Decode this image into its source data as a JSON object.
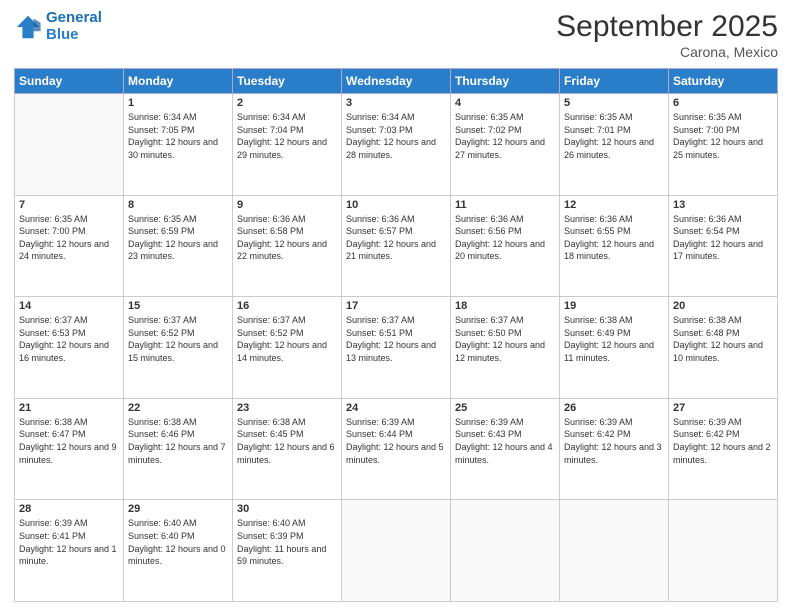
{
  "logo": {
    "line1": "General",
    "line2": "Blue"
  },
  "title": "September 2025",
  "location": "Carona, Mexico",
  "days_of_week": [
    "Sunday",
    "Monday",
    "Tuesday",
    "Wednesday",
    "Thursday",
    "Friday",
    "Saturday"
  ],
  "weeks": [
    [
      {
        "day": "",
        "sunrise": "",
        "sunset": "",
        "daylight": ""
      },
      {
        "day": "1",
        "sunrise": "Sunrise: 6:34 AM",
        "sunset": "Sunset: 7:05 PM",
        "daylight": "Daylight: 12 hours and 30 minutes."
      },
      {
        "day": "2",
        "sunrise": "Sunrise: 6:34 AM",
        "sunset": "Sunset: 7:04 PM",
        "daylight": "Daylight: 12 hours and 29 minutes."
      },
      {
        "day": "3",
        "sunrise": "Sunrise: 6:34 AM",
        "sunset": "Sunset: 7:03 PM",
        "daylight": "Daylight: 12 hours and 28 minutes."
      },
      {
        "day": "4",
        "sunrise": "Sunrise: 6:35 AM",
        "sunset": "Sunset: 7:02 PM",
        "daylight": "Daylight: 12 hours and 27 minutes."
      },
      {
        "day": "5",
        "sunrise": "Sunrise: 6:35 AM",
        "sunset": "Sunset: 7:01 PM",
        "daylight": "Daylight: 12 hours and 26 minutes."
      },
      {
        "day": "6",
        "sunrise": "Sunrise: 6:35 AM",
        "sunset": "Sunset: 7:00 PM",
        "daylight": "Daylight: 12 hours and 25 minutes."
      }
    ],
    [
      {
        "day": "7",
        "sunrise": "Sunrise: 6:35 AM",
        "sunset": "Sunset: 7:00 PM",
        "daylight": "Daylight: 12 hours and 24 minutes."
      },
      {
        "day": "8",
        "sunrise": "Sunrise: 6:35 AM",
        "sunset": "Sunset: 6:59 PM",
        "daylight": "Daylight: 12 hours and 23 minutes."
      },
      {
        "day": "9",
        "sunrise": "Sunrise: 6:36 AM",
        "sunset": "Sunset: 6:58 PM",
        "daylight": "Daylight: 12 hours and 22 minutes."
      },
      {
        "day": "10",
        "sunrise": "Sunrise: 6:36 AM",
        "sunset": "Sunset: 6:57 PM",
        "daylight": "Daylight: 12 hours and 21 minutes."
      },
      {
        "day": "11",
        "sunrise": "Sunrise: 6:36 AM",
        "sunset": "Sunset: 6:56 PM",
        "daylight": "Daylight: 12 hours and 20 minutes."
      },
      {
        "day": "12",
        "sunrise": "Sunrise: 6:36 AM",
        "sunset": "Sunset: 6:55 PM",
        "daylight": "Daylight: 12 hours and 18 minutes."
      },
      {
        "day": "13",
        "sunrise": "Sunrise: 6:36 AM",
        "sunset": "Sunset: 6:54 PM",
        "daylight": "Daylight: 12 hours and 17 minutes."
      }
    ],
    [
      {
        "day": "14",
        "sunrise": "Sunrise: 6:37 AM",
        "sunset": "Sunset: 6:53 PM",
        "daylight": "Daylight: 12 hours and 16 minutes."
      },
      {
        "day": "15",
        "sunrise": "Sunrise: 6:37 AM",
        "sunset": "Sunset: 6:52 PM",
        "daylight": "Daylight: 12 hours and 15 minutes."
      },
      {
        "day": "16",
        "sunrise": "Sunrise: 6:37 AM",
        "sunset": "Sunset: 6:52 PM",
        "daylight": "Daylight: 12 hours and 14 minutes."
      },
      {
        "day": "17",
        "sunrise": "Sunrise: 6:37 AM",
        "sunset": "Sunset: 6:51 PM",
        "daylight": "Daylight: 12 hours and 13 minutes."
      },
      {
        "day": "18",
        "sunrise": "Sunrise: 6:37 AM",
        "sunset": "Sunset: 6:50 PM",
        "daylight": "Daylight: 12 hours and 12 minutes."
      },
      {
        "day": "19",
        "sunrise": "Sunrise: 6:38 AM",
        "sunset": "Sunset: 6:49 PM",
        "daylight": "Daylight: 12 hours and 11 minutes."
      },
      {
        "day": "20",
        "sunrise": "Sunrise: 6:38 AM",
        "sunset": "Sunset: 6:48 PM",
        "daylight": "Daylight: 12 hours and 10 minutes."
      }
    ],
    [
      {
        "day": "21",
        "sunrise": "Sunrise: 6:38 AM",
        "sunset": "Sunset: 6:47 PM",
        "daylight": "Daylight: 12 hours and 9 minutes."
      },
      {
        "day": "22",
        "sunrise": "Sunrise: 6:38 AM",
        "sunset": "Sunset: 6:46 PM",
        "daylight": "Daylight: 12 hours and 7 minutes."
      },
      {
        "day": "23",
        "sunrise": "Sunrise: 6:38 AM",
        "sunset": "Sunset: 6:45 PM",
        "daylight": "Daylight: 12 hours and 6 minutes."
      },
      {
        "day": "24",
        "sunrise": "Sunrise: 6:39 AM",
        "sunset": "Sunset: 6:44 PM",
        "daylight": "Daylight: 12 hours and 5 minutes."
      },
      {
        "day": "25",
        "sunrise": "Sunrise: 6:39 AM",
        "sunset": "Sunset: 6:43 PM",
        "daylight": "Daylight: 12 hours and 4 minutes."
      },
      {
        "day": "26",
        "sunrise": "Sunrise: 6:39 AM",
        "sunset": "Sunset: 6:42 PM",
        "daylight": "Daylight: 12 hours and 3 minutes."
      },
      {
        "day": "27",
        "sunrise": "Sunrise: 6:39 AM",
        "sunset": "Sunset: 6:42 PM",
        "daylight": "Daylight: 12 hours and 2 minutes."
      }
    ],
    [
      {
        "day": "28",
        "sunrise": "Sunrise: 6:39 AM",
        "sunset": "Sunset: 6:41 PM",
        "daylight": "Daylight: 12 hours and 1 minute."
      },
      {
        "day": "29",
        "sunrise": "Sunrise: 6:40 AM",
        "sunset": "Sunset: 6:40 PM",
        "daylight": "Daylight: 12 hours and 0 minutes."
      },
      {
        "day": "30",
        "sunrise": "Sunrise: 6:40 AM",
        "sunset": "Sunset: 6:39 PM",
        "daylight": "Daylight: 11 hours and 59 minutes."
      },
      {
        "day": "",
        "sunrise": "",
        "sunset": "",
        "daylight": ""
      },
      {
        "day": "",
        "sunrise": "",
        "sunset": "",
        "daylight": ""
      },
      {
        "day": "",
        "sunrise": "",
        "sunset": "",
        "daylight": ""
      },
      {
        "day": "",
        "sunrise": "",
        "sunset": "",
        "daylight": ""
      }
    ]
  ]
}
